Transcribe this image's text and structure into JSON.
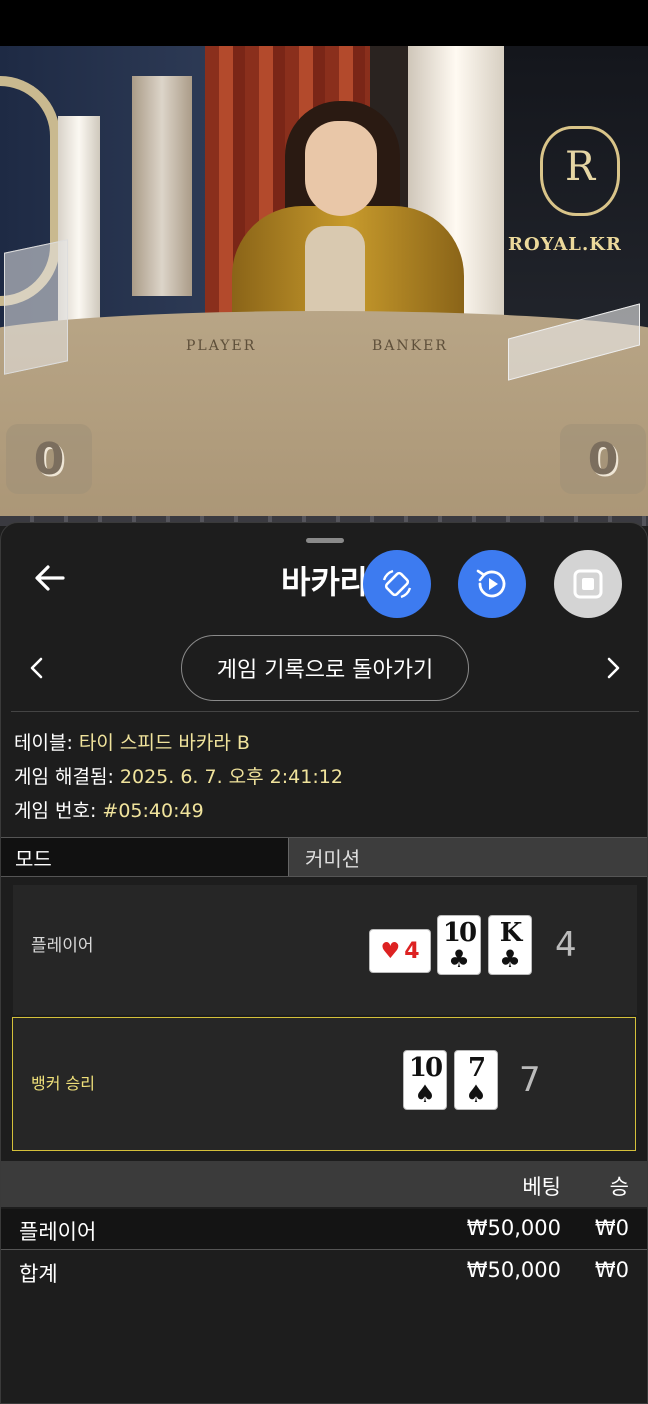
{
  "video": {
    "brand_logo_text": "ROYAL.KR",
    "table_labels": {
      "player": "PLAYER",
      "banker": "BANKER"
    },
    "player_score": "0",
    "banker_score": "0"
  },
  "panel": {
    "title": "바카라",
    "icons": {
      "back": "arrow-left-icon",
      "rotate": "rotate-icon",
      "replay": "replay-icon",
      "stop": "stop-icon",
      "prev": "chevron-left-icon",
      "next": "chevron-right-icon"
    },
    "colors": {
      "accent_blue": "#3d7bf0",
      "highlight_yellow": "#d4c03a",
      "value_yellow": "#f0e39c"
    },
    "history_button": "게임 기록으로 돌아가기",
    "info": {
      "table_label": "테이블:",
      "table_value": "타이 스피드 바카라 B",
      "resolved_label": "게임 해결됨:",
      "resolved_value": "2025. 6. 7. 오후 2:41:12",
      "game_no_label": "게임 번호:",
      "game_no_value": "#05:40:49"
    },
    "mode_tabs": [
      "모드",
      "커미션"
    ],
    "player": {
      "label": "플레이어",
      "cards": [
        {
          "rank": "4",
          "suit": "♥",
          "orientation": "sideways"
        },
        {
          "rank": "10",
          "suit": "♣"
        },
        {
          "rank": "K",
          "suit": "♣"
        }
      ],
      "total": "4"
    },
    "banker": {
      "label": "뱅커 승리",
      "cards": [
        {
          "rank": "10",
          "suit": "♠"
        },
        {
          "rank": "7",
          "suit": "♠"
        }
      ],
      "total": "7"
    },
    "bets": {
      "headers": {
        "bet": "베팅",
        "win": "승"
      },
      "rows": [
        {
          "name": "플레이어",
          "bet": "₩50,000",
          "win": "₩0"
        }
      ],
      "total": {
        "name": "합계",
        "bet": "₩50,000",
        "win": "₩0"
      }
    }
  }
}
